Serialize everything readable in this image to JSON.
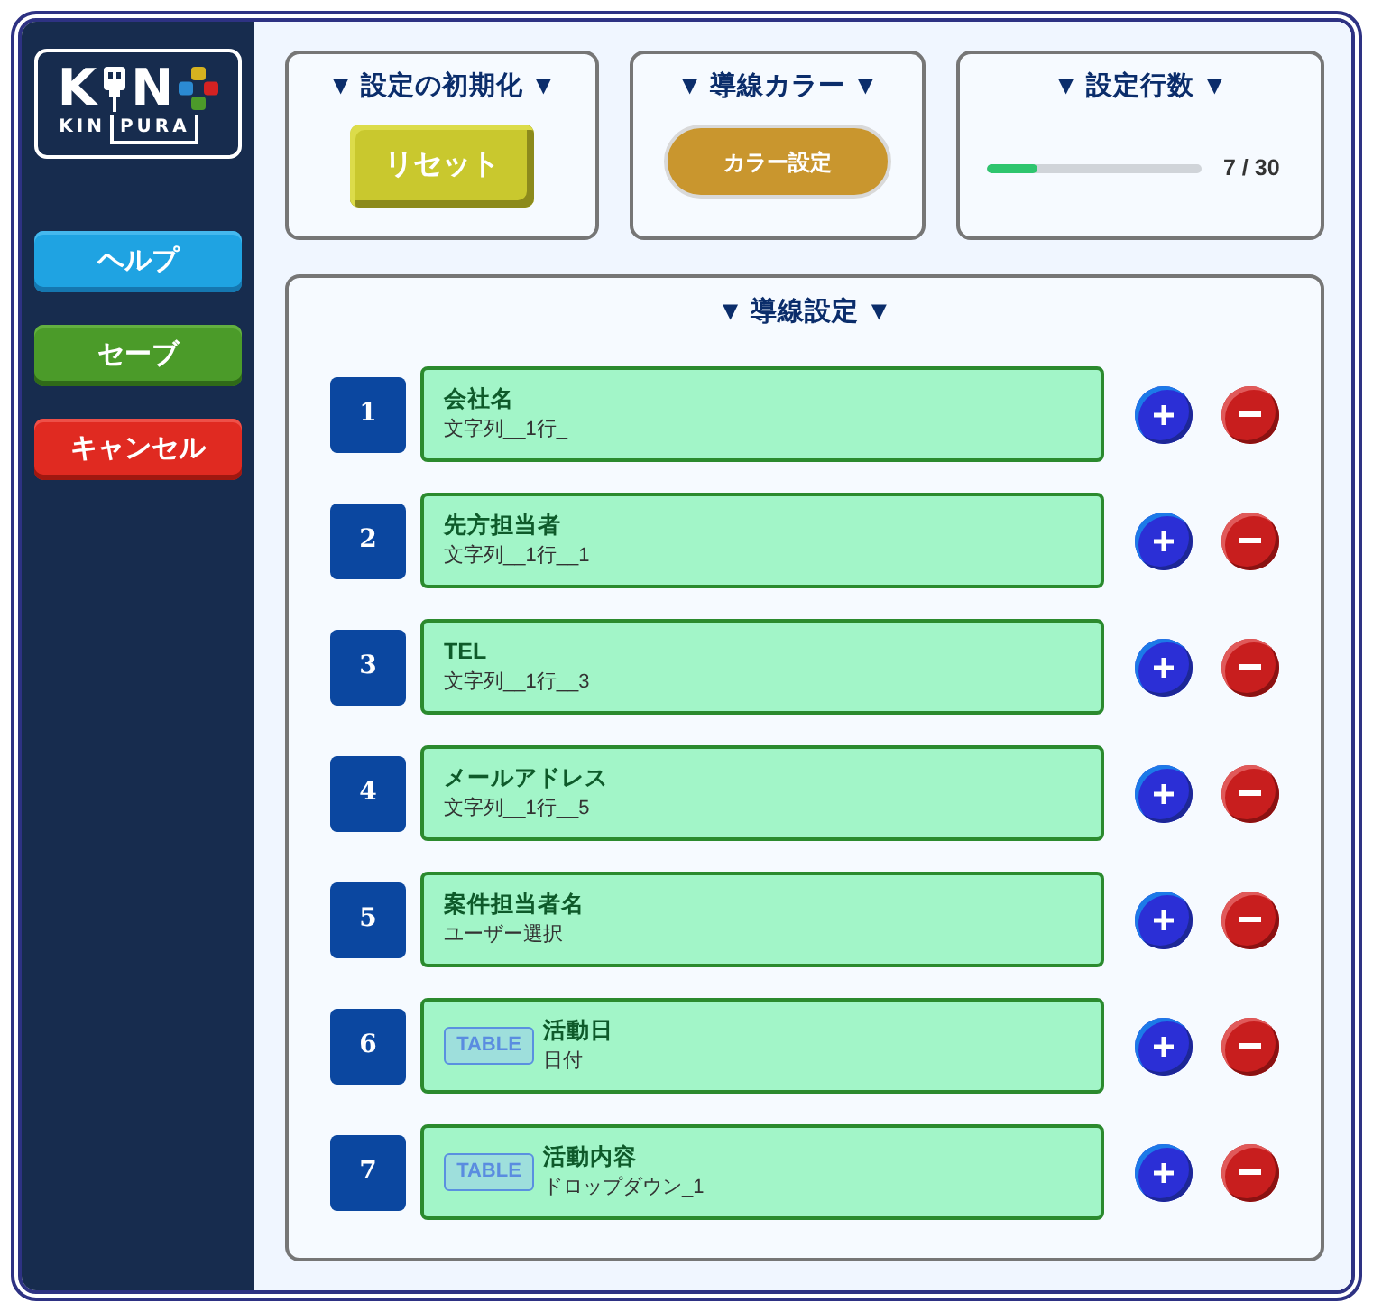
{
  "sidebar": {
    "logo": {
      "mark": [
        "K",
        "N"
      ],
      "caption": [
        "KIN",
        "PURA"
      ]
    },
    "buttons": [
      {
        "label": "ヘルプ",
        "kind": "help"
      },
      {
        "label": "セーブ",
        "kind": "save"
      },
      {
        "label": "キャンセル",
        "kind": "cancel"
      }
    ]
  },
  "panels": [
    {
      "kind": "reset",
      "title": "▼ 設定の初期化 ▼",
      "button": "リセット"
    },
    {
      "kind": "color",
      "title": "▼ 導線カラー ▼",
      "button": "カラー設定"
    },
    {
      "kind": "row_count",
      "title": "▼ 設定行数 ▼",
      "level": 0.233,
      "reading": "7 / 30"
    }
  ],
  "flow_settings": {
    "title": "▼ 導線設定 ▼",
    "rows": [
      {
        "number": "1",
        "label": "会社名",
        "detail": "文字列__1行_"
      },
      {
        "number": "2",
        "label": "先方担当者",
        "detail": "文字列__1行__1"
      },
      {
        "number": "3",
        "label": "TEL",
        "detail": "文字列__1行__3"
      },
      {
        "number": "4",
        "label": "メールアドレス",
        "detail": "文字列__1行__5"
      },
      {
        "number": "5",
        "label": "案件担当者名",
        "detail": "ユーザー選択"
      },
      {
        "number": "6",
        "badge": "TABLE",
        "label": "活動日",
        "detail": "日付"
      },
      {
        "number": "7",
        "badge": "TABLE",
        "label": "活動内容",
        "detail": "ドロップダウン_1"
      }
    ]
  }
}
